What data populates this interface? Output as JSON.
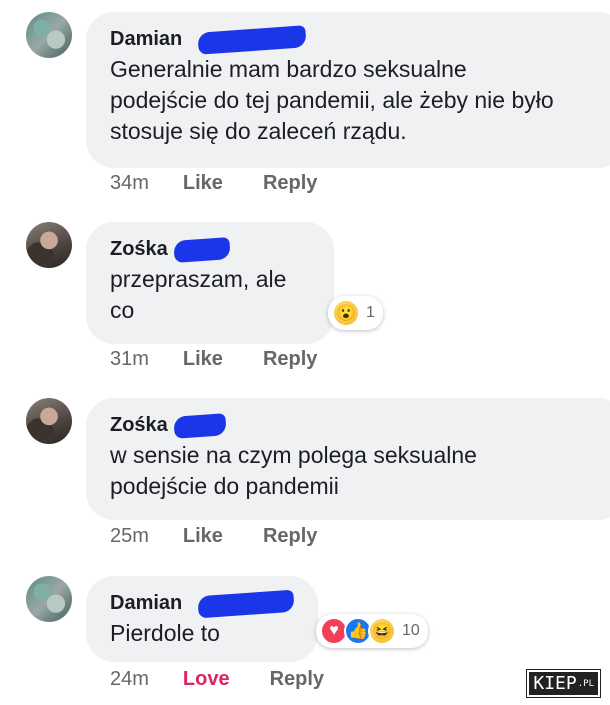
{
  "comments": [
    {
      "author": "Damian",
      "text": "Generalnie mam bardzo seksualne\npodejście do tej pandemii, ale żeby nie było\nstosuje się do zaleceń rządu.",
      "time": "34m",
      "action_1": "Like",
      "reply": "Reply"
    },
    {
      "author": "Zośka",
      "text": "przepraszam, ale\nco",
      "time": "31m",
      "action_1": "Like",
      "reply": "Reply",
      "reaction": {
        "icons": [
          "wow-icon"
        ],
        "count": "1"
      }
    },
    {
      "author": "Zośka",
      "text": "w sensie na czym polega seksualne\npodejście do pandemii",
      "time": "25m",
      "action_1": "Like",
      "reply": "Reply"
    },
    {
      "author": "Damian",
      "text": "Pierdole to",
      "time": "24m",
      "action_1": "Love",
      "reply": "Reply",
      "reaction": {
        "icons": [
          "love-icon",
          "like-icon",
          "haha-icon"
        ],
        "count": "10"
      }
    }
  ],
  "watermark": {
    "main": "KIEP",
    "suffix": ".PL"
  },
  "colors": {
    "bubble": "#eff1f3",
    "meta": "#65676b",
    "love": "#e0245e",
    "redaction": "#1a36e8"
  }
}
